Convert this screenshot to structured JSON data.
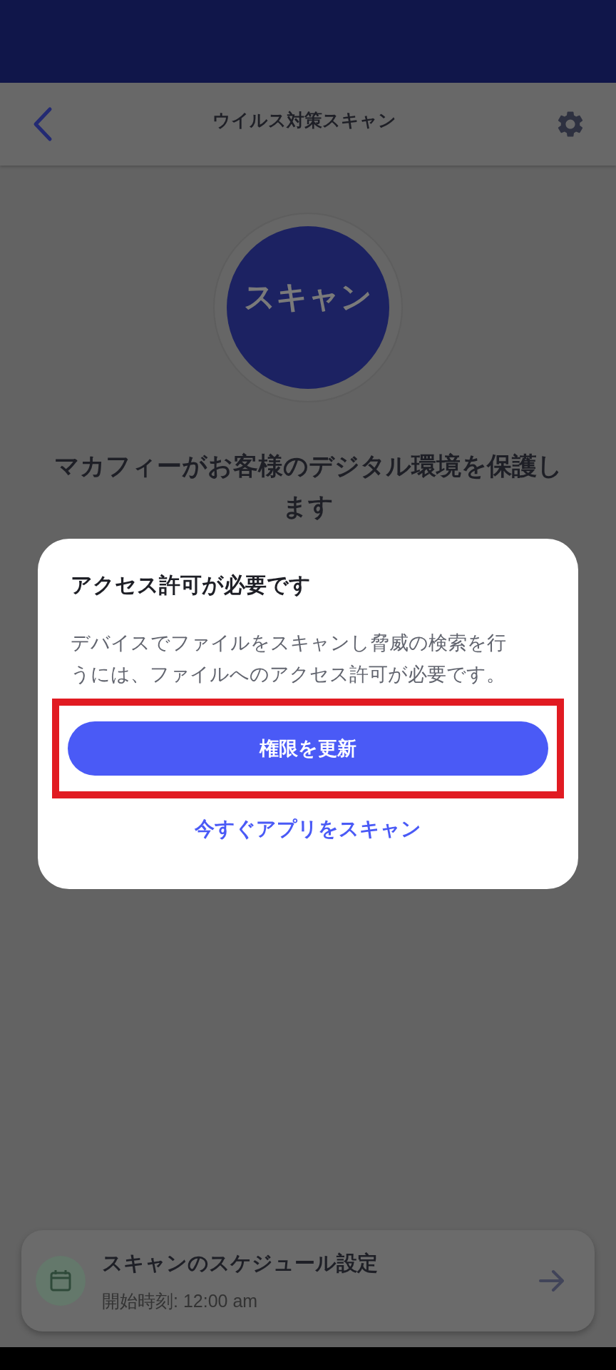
{
  "app_bar": {
    "title": "ウイルス対策スキャン"
  },
  "scan_button": {
    "label": "スキャン"
  },
  "headline": "マカフィーがお客様のデジタル環境を保護します",
  "dialog": {
    "title": "アクセス許可が必要です",
    "message": "デバイスでファイルをスキャンし脅威の検索を行うには、ファイルへのアクセス許可が必要です。",
    "primary_button": {
      "label": "権限を更新",
      "highlighted": true
    },
    "secondary_link": "今すぐアプリをスキャン"
  },
  "schedule_card": {
    "title": "スキャンのスケジュール設定",
    "subtitle": "開始時刻: 12:00 am"
  }
}
